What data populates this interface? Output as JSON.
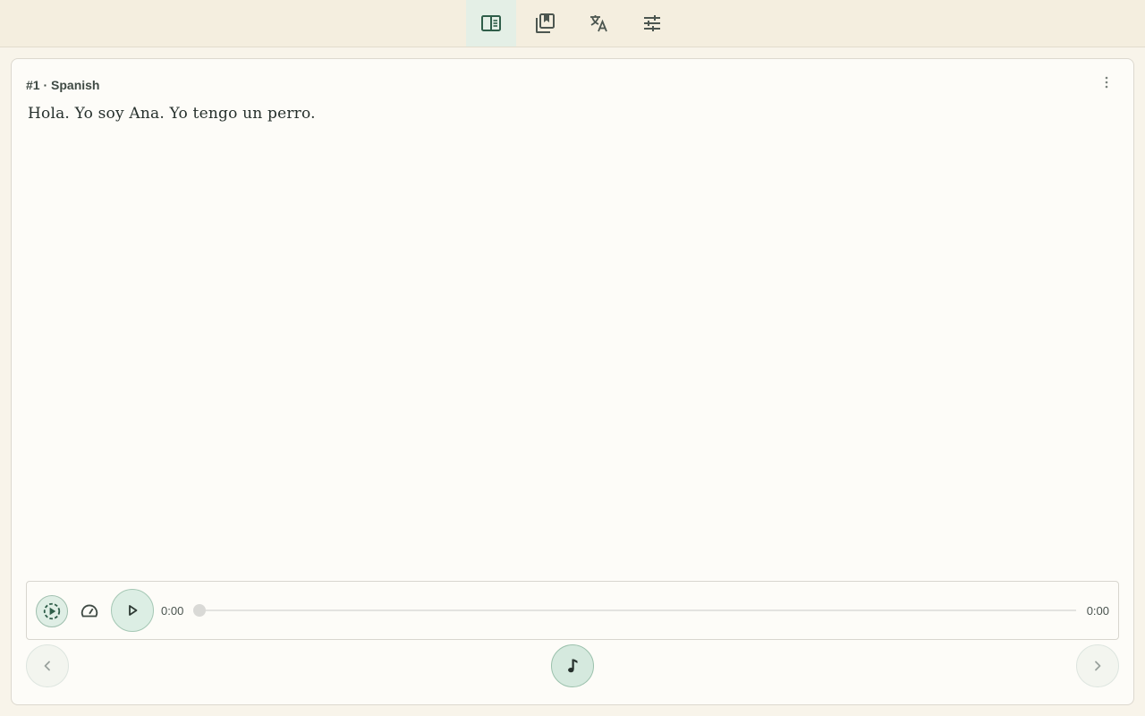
{
  "header": {
    "tabs": [
      {
        "icon": "reader-icon",
        "active": true
      },
      {
        "icon": "library-icon",
        "active": false
      },
      {
        "icon": "translate-icon",
        "active": false
      },
      {
        "icon": "settings-sliders-icon",
        "active": false
      }
    ]
  },
  "card": {
    "title": "#1 · Spanish",
    "text": "Hola. Yo soy Ana. Yo tengo un perro."
  },
  "player": {
    "current_time": "0:00",
    "total_time": "0:00",
    "progress": 0
  },
  "colors": {
    "accent": "#2f5e49",
    "active_tab_bg": "#e4efe6",
    "icon": "#4c5650"
  }
}
